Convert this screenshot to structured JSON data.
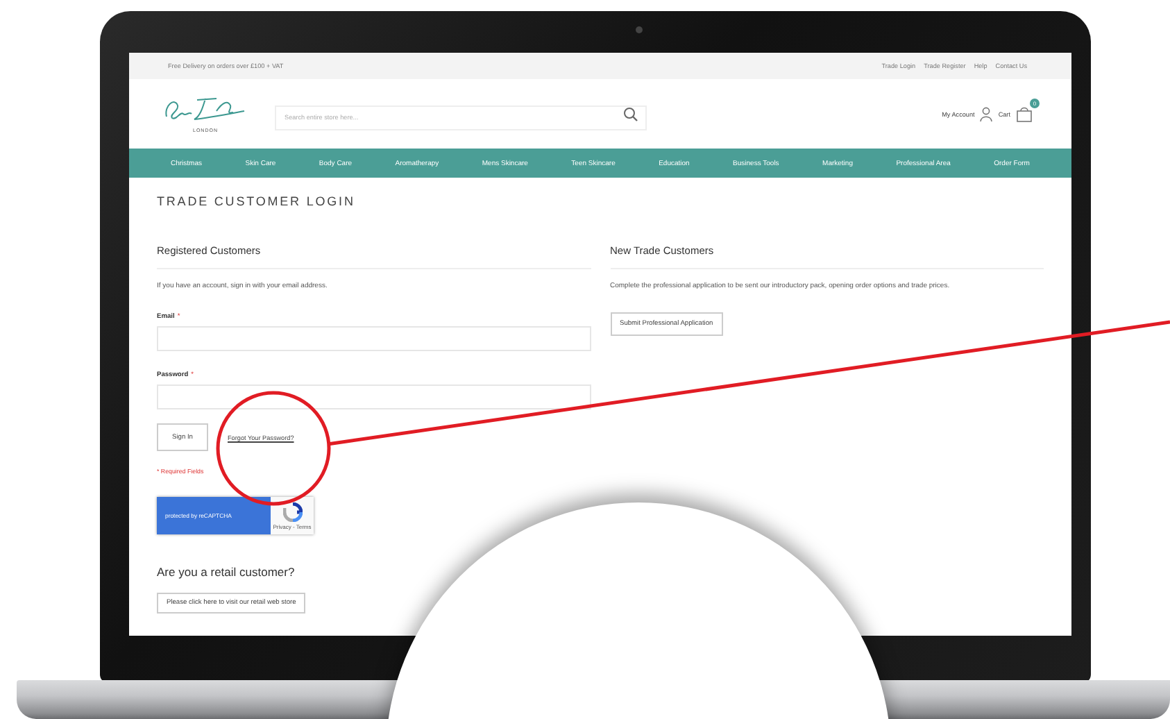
{
  "top_bar": {
    "notice": "Free Delivery on orders over £100 + VAT",
    "links": [
      "Trade Login",
      "Trade Register",
      "Help",
      "Contact Us"
    ]
  },
  "header": {
    "logo_subtitle": "LONDON",
    "search": {
      "placeholder": "Search entire store here..."
    },
    "account": "My Account",
    "cart": {
      "label": "Cart",
      "count": "0"
    }
  },
  "nav": [
    "Christmas",
    "Skin Care",
    "Body Care",
    "Aromatherapy",
    "Mens Skincare",
    "Teen Skincare",
    "Education",
    "Business Tools",
    "Marketing",
    "Professional Area",
    "Order Form"
  ],
  "page_title": "TRADE CUSTOMER LOGIN",
  "registered": {
    "heading": "Registered Customers",
    "intro": "If you have an account, sign in with your email address.",
    "email_label": "Email",
    "password_label": "Password",
    "required_mark": "*",
    "sign_in": "Sign In",
    "forgot": "Forgot Your Password?",
    "required_note": "* Required Fields",
    "recaptcha": {
      "badge": "protected by reCAPTCHA",
      "links": "Privacy - Terms"
    }
  },
  "new_customers": {
    "heading": "New Trade Customers",
    "text": "Complete the professional application to be sent our introductory pack, opening order options and trade prices.",
    "button": "Submit Professional Application"
  },
  "retail": {
    "heading": "Are you a retail customer?",
    "button": "Please click here to visit our retail web store"
  }
}
